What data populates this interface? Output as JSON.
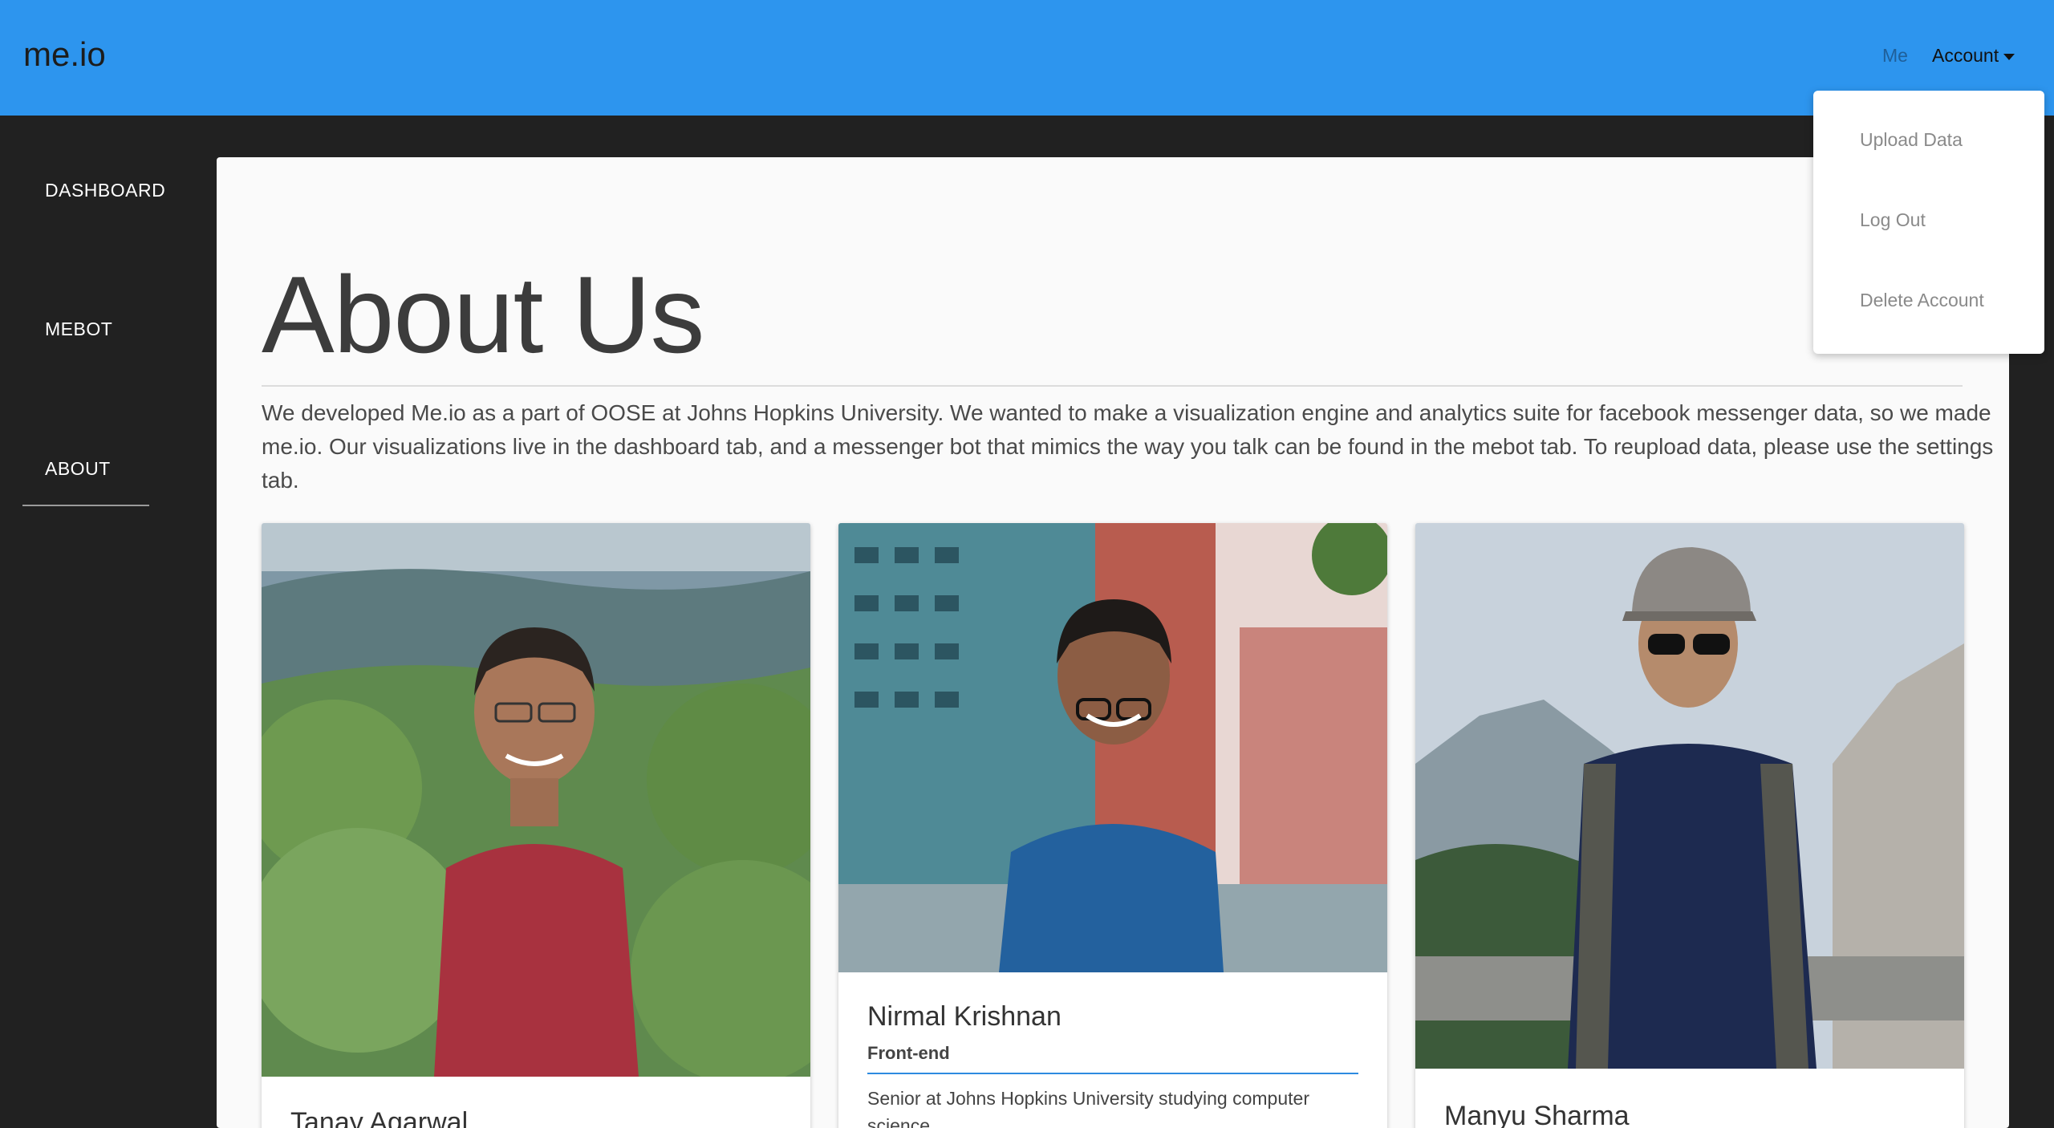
{
  "header": {
    "brand": "me.io",
    "nav": {
      "me": "Me",
      "account": "Account"
    }
  },
  "sidebar": {
    "items": [
      {
        "label": "DASHBOARD"
      },
      {
        "label": "MEBOT"
      },
      {
        "label": "ABOUT"
      }
    ]
  },
  "about": {
    "title": "About Us",
    "intro": "We developed Me.io as a part of OOSE at Johns Hopkins University. We wanted to make a visualization engine and analytics suite for facebook messenger data, so we made me.io. Our visualizations live in the dashboard tab, and a messenger bot that mimics the way you talk can be found in the mebot tab. To reupload data, please use the settings tab."
  },
  "team": [
    {
      "name": "Tanay Agarwal"
    },
    {
      "name": "Nirmal Krishnan",
      "role": "Front-end",
      "desc": "Senior at Johns Hopkins University studying computer science"
    },
    {
      "name": "Manyu Sharma"
    }
  ],
  "account_menu": {
    "items": [
      {
        "label": "Upload Data"
      },
      {
        "label": "Log Out"
      },
      {
        "label": "Delete Account"
      }
    ]
  },
  "colors": {
    "topbar": "#2d95ee",
    "sidebar": "#212121",
    "card_accent": "#2d8be0"
  }
}
